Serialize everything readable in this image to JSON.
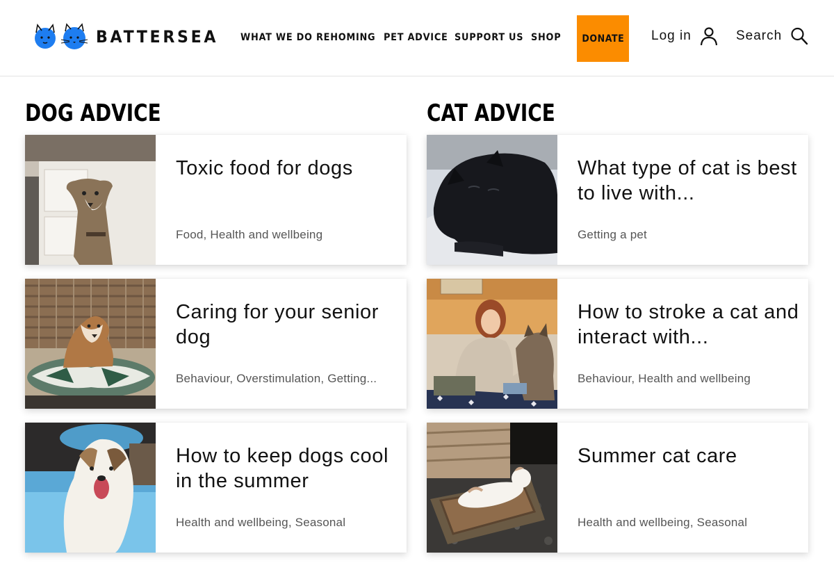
{
  "header": {
    "logo_text": "BATTERSEA",
    "nav": [
      "WHAT WE DO",
      "REHOMING",
      "PET ADVICE",
      "SUPPORT US",
      "SHOP"
    ],
    "donate_label": "DONATE",
    "login_label": "Log in",
    "search_label": "Search",
    "donate_color": "#fb8c00",
    "logo_color": "#1e7df0"
  },
  "dog": {
    "heading": "DOG ADVICE",
    "cards": [
      {
        "title": "Toxic food for dogs",
        "tags": "Food, Health and wellbeing",
        "image": "greyhound-kitchen"
      },
      {
        "title": "Caring for your senior dog",
        "tags": "Behaviour, Overstimulation, Getting...",
        "image": "senior-dog-cushion"
      },
      {
        "title": "How to keep dogs cool in the summer",
        "tags": "Health and wellbeing, Seasonal",
        "image": "dog-paddling-pool"
      }
    ]
  },
  "cat": {
    "heading": "CAT ADVICE",
    "cards": [
      {
        "title": "What type of cat is best to live with...",
        "tags": "Getting a pet",
        "image": "black-cat-sleeping"
      },
      {
        "title": "How to stroke a cat and interact with...",
        "tags": "Behaviour, Health and wellbeing",
        "image": "woman-stroking-cat"
      },
      {
        "title": "Summer cat care",
        "tags": "Health and wellbeing, Seasonal",
        "image": "white-cat-sunbathing"
      }
    ]
  }
}
